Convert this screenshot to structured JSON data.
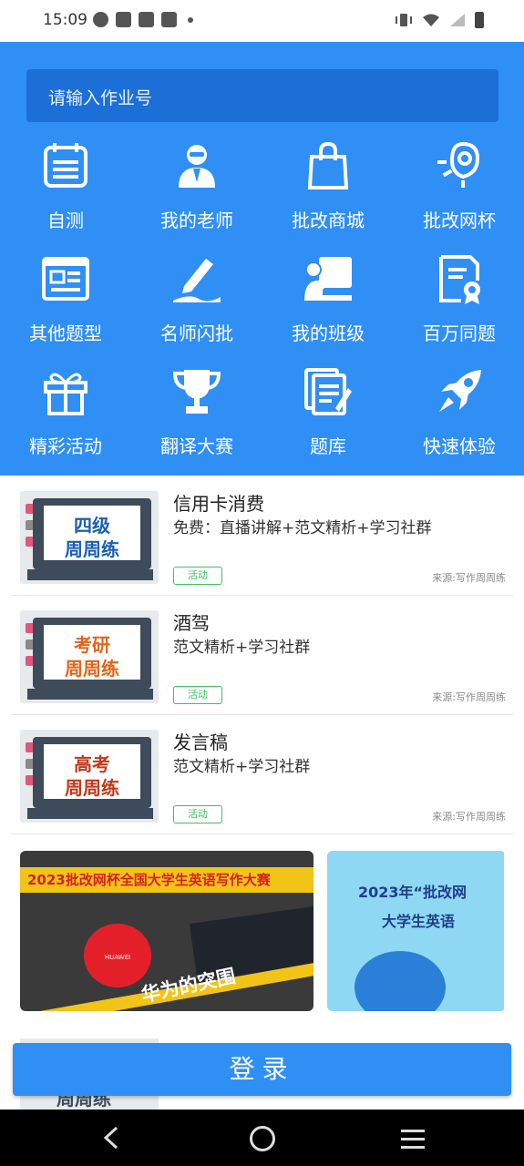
{
  "status": {
    "time": "15:09"
  },
  "search": {
    "placeholder": "请输入作业号"
  },
  "grid": [
    {
      "label": "自测",
      "icon": "calendar-icon"
    },
    {
      "label": "我的老师",
      "icon": "teacher-icon"
    },
    {
      "label": "批改商城",
      "icon": "shopping-bag-icon"
    },
    {
      "label": "批改网杯",
      "icon": "rocket-medal-icon"
    },
    {
      "label": "其他题型",
      "icon": "document-layout-icon"
    },
    {
      "label": "名师闪批",
      "icon": "pen-write-icon"
    },
    {
      "label": "我的班级",
      "icon": "classroom-icon"
    },
    {
      "label": "百万同题",
      "icon": "certificate-icon"
    },
    {
      "label": "精彩活动",
      "icon": "gift-icon"
    },
    {
      "label": "翻译大赛",
      "icon": "trophy-icon"
    },
    {
      "label": "题库",
      "icon": "question-bank-icon"
    },
    {
      "label": "快速体验",
      "icon": "rocket-icon"
    }
  ],
  "cards": [
    {
      "thumb_line1": "四级",
      "thumb_line2": "周周练",
      "thumb_color": "#1b5fb5",
      "title": "信用卡消费",
      "subtitle": "免费：直播讲解+范文精析+学习社群",
      "tag": "活动",
      "source": "来源:写作周周练"
    },
    {
      "thumb_line1": "考研",
      "thumb_line2": "周周练",
      "thumb_color": "#e2651a",
      "title": "酒驾",
      "subtitle": "范文精析+学习社群",
      "tag": "活动",
      "source": "来源:写作周周练"
    },
    {
      "thumb_line1": "高考",
      "thumb_line2": "周周练",
      "thumb_color": "#c0391b",
      "title": "发言稿",
      "subtitle": "范文精析+学习社群",
      "tag": "活动",
      "source": "来源:写作周周练"
    }
  ],
  "banners": {
    "banner1_title": "2023批改网杯全国大学生英语写作大赛",
    "banner1_brand": "HUAWEI",
    "banner1_slogan": "华为的突围",
    "banner2_top": "2023年“批改网",
    "banner2_bottom": "大学生英语"
  },
  "partial": {
    "text": "周周练"
  },
  "login": {
    "label": "登录"
  },
  "colors": {
    "primary": "#2f8ff5",
    "search_bg": "#1d6fd8",
    "tag_green": "#3fbf62"
  }
}
